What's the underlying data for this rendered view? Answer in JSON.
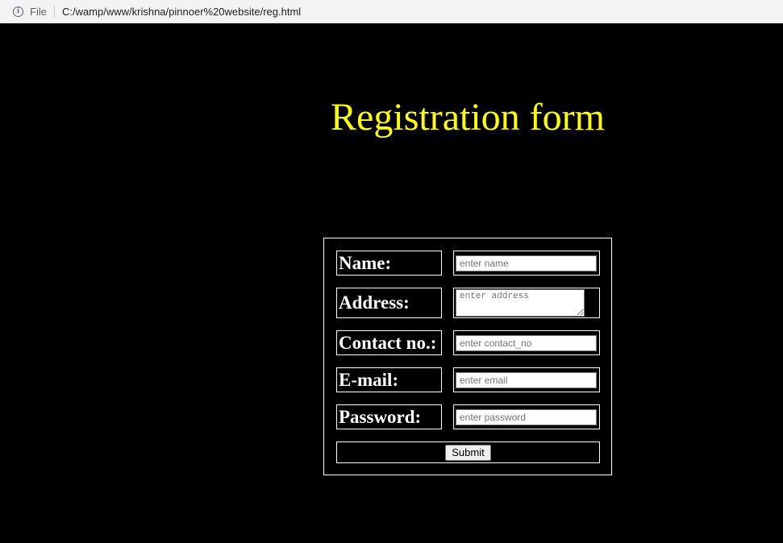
{
  "browser": {
    "scheme": "File",
    "url": "C:/wamp/www/krishna/pinnoer%20website/reg.html",
    "info_icon": "info-icon"
  },
  "page": {
    "title": "Registration form"
  },
  "form": {
    "fields": [
      {
        "label": "Name:",
        "placeholder": "enter name"
      },
      {
        "label": "Address:",
        "placeholder": "enter address"
      },
      {
        "label": "Contact no.:",
        "placeholder": "enter contact_no"
      },
      {
        "label": "E-mail:",
        "placeholder": "enter email"
      },
      {
        "label": "Password:",
        "placeholder": "enter password"
      }
    ],
    "submit_label": "Submit"
  },
  "colors": {
    "background": "#000000",
    "title": "#ffff00",
    "text": "#ffffff"
  }
}
